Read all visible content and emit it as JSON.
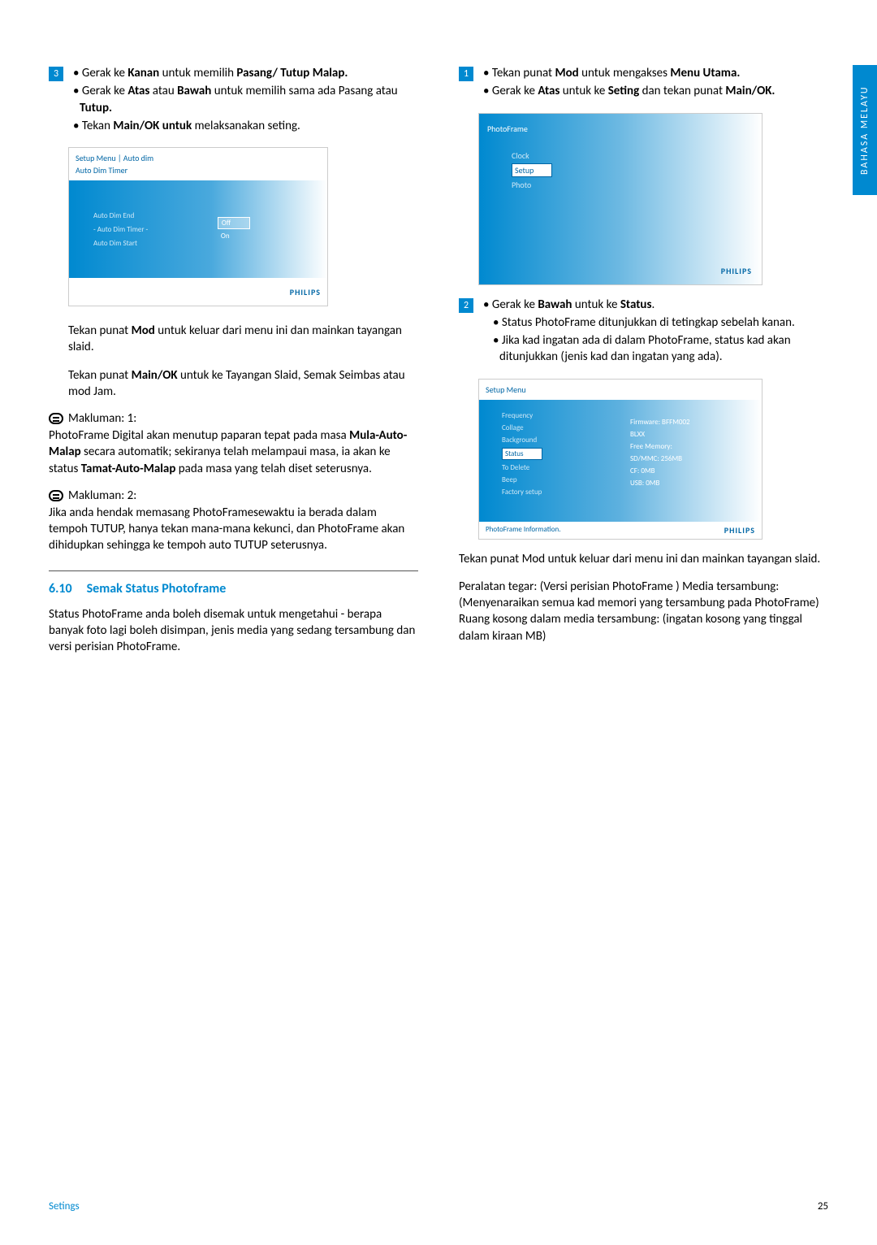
{
  "sideTab": "BAHASA MELAYU",
  "left": {
    "step3": {
      "num": "3",
      "line1_a": "Gerak ke ",
      "line1_b": "Kanan",
      "line1_c": " untuk memilih ",
      "line1_d": "Pasang/ Tutup Malap.",
      "line2_a": "Gerak ke ",
      "line2_b": "Atas",
      "line2_c": " atau ",
      "line2_d": "Bawah",
      "line2_e": " untuk memilih sama ada Pasang atau ",
      "line2_f": "Tutup.",
      "line3_a": "Tekan ",
      "line3_b": "Main/OK untuk",
      "line3_c": " melaksanakan seting."
    },
    "screenA": {
      "header": "Setup Menu | Auto dim",
      "sub": "Auto Dim Timer",
      "items": [
        "Auto Dim End",
        "- Auto Dim Timer -",
        "Auto Dim Start"
      ],
      "opts": [
        "Off",
        "On"
      ],
      "brand": "PHILIPS"
    },
    "after1_a": "Tekan punat ",
    "after1_b": "Mod",
    "after1_c": " untuk keluar dari menu ini dan mainkan tayangan slaid.",
    "after2_a": "Tekan punat ",
    "after2_b": "Main/OK",
    "after2_c": " untuk ke Tayangan Slaid, Semak Seimbas atau mod Jam.",
    "note1_h": "Makluman: 1:",
    "note1_a": "PhotoFrame Digital  akan menutup paparan tepat pada masa ",
    "note1_b": "Mula-Auto-Malap",
    "note1_c": " secara automatik; sekiranya telah melampaui masa, ia akan ke status ",
    "note1_d": "Tamat-Auto-Malap",
    "note1_e": " pada masa yang telah diset seterusnya.",
    "note2_h": "Makluman: 2:",
    "note2": "Jika anda hendak memasang PhotoFramesewaktu ia berada dalam tempoh TUTUP, hanya tekan mana-mana kekunci, dan PhotoFrame akan dihidupkan sehingga ke tempoh auto TUTUP seterusnya.",
    "secNum": "6.10",
    "secTitle": "Semak Status Photoframe",
    "secPara": "Status PhotoFrame anda boleh disemak untuk mengetahui - berapa banyak foto lagi boleh disimpan, jenis media yang sedang tersambung dan versi perisian PhotoFrame."
  },
  "right": {
    "step1": {
      "num": "1",
      "line1_a": "Tekan punat ",
      "line1_b": "Mod",
      "line1_c": " untuk mengakses ",
      "line1_d": "Menu Utama.",
      "line2_a": "Gerak ke ",
      "line2_b": "Atas",
      "line2_c": " untuk ke ",
      "line2_d": "Seting",
      "line2_e": " dan tekan punat ",
      "line2_f": "Main/OK."
    },
    "screenB": {
      "title": "PhotoFrame",
      "items": [
        "Clock",
        "Setup",
        "Photo"
      ],
      "brand": "PHILIPS"
    },
    "step2": {
      "num": "2",
      "line1_a": "Gerak ke ",
      "line1_b": "Bawah",
      "line1_c": " untuk ke ",
      "line1_d": "Status",
      "line2": "Status PhotoFrame ditunjukkan di tetingkap sebelah kanan.",
      "line3": "Jika kad ingatan ada di dalam PhotoFrame, status kad akan ditunjukkan (jenis kad dan ingatan yang ada)."
    },
    "screenC": {
      "header": "Setup Menu",
      "leftItems": [
        "Frequency",
        "Collage",
        "Background",
        "Status",
        "To Delete",
        "Beep",
        "Factory setup"
      ],
      "rightItems": [
        "Firmware: BFFM002",
        "BLXX",
        "Free Memory:",
        "SD/MMC: 256MB",
        "CF: 0MB",
        "USB: 0MB"
      ],
      "footerL": "PhotoFrame Information.",
      "brand": "PHILIPS"
    },
    "after1": "Tekan punat Mod untuk keluar dari menu ini dan mainkan tayangan slaid.",
    "after2": "Peralatan tegar: (Versi perisian PhotoFrame ) Media tersambung: (Menyenaraikan semua kad memori yang tersambung pada PhotoFrame) Ruang kosong dalam media tersambung: (ingatan kosong yang tinggal dalam kiraan MB)"
  },
  "footer": {
    "left": "Setings",
    "right": "25"
  }
}
